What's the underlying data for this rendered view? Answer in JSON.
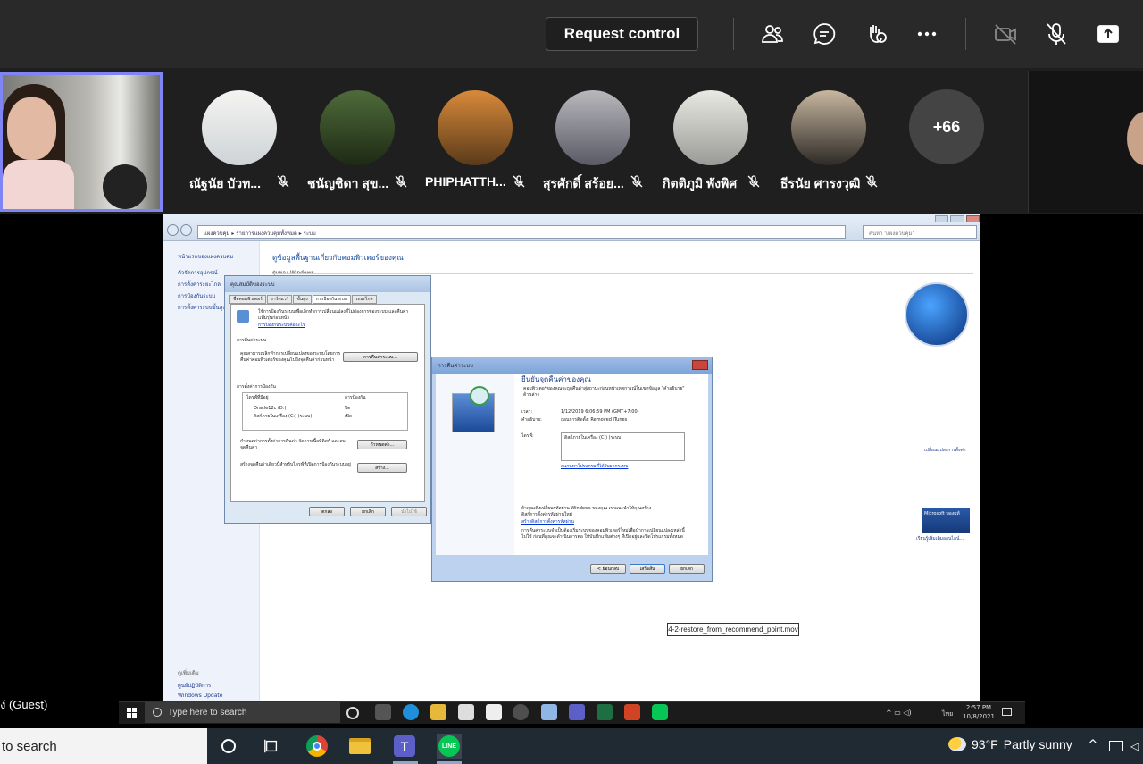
{
  "toolbar": {
    "request_control_label": "Request control",
    "icons": [
      "people-icon",
      "chat-icon",
      "raise-hand-icon",
      "more-icon",
      "camera-off-icon",
      "mic-off-icon",
      "share-tray-icon"
    ]
  },
  "participants": [
    {
      "name": "ณัฐนัย บัวท...",
      "muted": true
    },
    {
      "name": "ชนัญชิดา สุข...",
      "muted": true
    },
    {
      "name": "PHIPHATTH...",
      "muted": true
    },
    {
      "name": "สุรศักดิ์ สร้อย...",
      "muted": true
    },
    {
      "name": "กิตติภูมิ พังพิศ",
      "muted": true
    },
    {
      "name": "ธีรนัย ศารงวุฒิ",
      "muted": true
    }
  ],
  "overflow_count": "+66",
  "self_label": "ง่ (Guest)",
  "shared_screen": {
    "address": "แผงควบคุม ▸ รายการแผงควบคุมทั้งหมด ▸ ระบบ",
    "search_placeholder": "ค้นหา 'แผงควบคุม'",
    "left_nav": {
      "home": "หน้าแรกของแผงควบคุม",
      "items": [
        "ตัวจัดการอุปกรณ์",
        "การตั้งค่าระยะไกล",
        "การป้องกันระบบ",
        "การตั้งค่าระบบขั้นสูง"
      ],
      "see_also": "ดูเพิ่มเติม",
      "see_also_items": [
        "ศูนย์ปฏิบัติการ",
        "Windows Update"
      ]
    },
    "page_title": "ดูข้อมูลพื้นฐานเกี่ยวกับคอมพิวเตอร์ของคุณ",
    "edition_label": "รุ่นของ Windows",
    "change_settings": "เปลี่ยนแปลงการตั้งค่า",
    "genuine_label": "เรียนรู้เพิ่มเติมออนไลน์...",
    "genuine_badge": "Microsoft ของแท้",
    "sysprops": {
      "title": "คุณสมบัติของระบบ",
      "tabs": [
        "ชื่อคอมพิวเตอร์",
        "ฮาร์ดแวร์",
        "ขั้นสูง",
        "การป้องกันระบบ",
        "ระยะไกล"
      ],
      "intro": "ใช้การป้องกันระบบเพื่อเลิกทำการเปลี่ยนแปลงที่ไม่ต้องการของระบบ และคืนค่าแฟ้มรุ่นก่อนหน้า",
      "intro_link": "การป้องกันระบบคืออะไร",
      "restore_section": "การคืนค่าระบบ",
      "restore_text": "คุณสามารถเลิกทำการเปลี่ยนแปลงของระบบโดยการคืนค่าคอมพิวเตอร์ของคุณไปยังจุดคืนค่าก่อนหน้า",
      "restore_button": "การคืนค่าระบบ...",
      "protection_section": "การตั้งค่าการป้องกัน",
      "col_drive": "ไดรฟ์ที่มีอยู่",
      "col_protection": "การป้องกัน",
      "drives": [
        {
          "name": "Oracle12c (D:)",
          "state": "ปิด"
        },
        {
          "name": "ดิสก์ภายในเครื่อง (C:) (ระบบ)",
          "state": "เปิด"
        }
      ],
      "configure_text": "กำหนดค่าการตั้งค่าการคืนค่า จัดการเนื้อที่ดิสก์ และลบจุดคืนค่า",
      "configure_button": "กำหนดค่า...",
      "create_text": "สร้างจุดคืนค่าเดี๋ยวนี้สำหรับไดรฟ์ที่เปิดการป้องกันระบบอยู่",
      "create_button": "สร้าง...",
      "ok": "ตกลง",
      "cancel": "ยกเลิก",
      "apply": "นำไปใช้"
    },
    "restore": {
      "title": "การคืนค่าระบบ",
      "heading": "ยืนยันจุดคืนค่าของคุณ",
      "subheading": "คอมพิวเตอร์ของคุณจะถูกคืนค่าสู่สถานะก่อนหน้าเหตุการณ์ในเขตข้อมูล \"คำอธิบาย\" ด้านล่าง",
      "time_label": "เวลา:",
      "time_value": "1/12/2019 6:06:59 PM (GMT+7:00)",
      "desc_label": "คำอธิบาย:",
      "desc_value": "ถอนการติดตั้ง: Removed iTunes",
      "drives_label": "ไดรฟ์:",
      "drives_value": "ดิสก์ภายในเครื่อง (C:) (ระบบ)",
      "scan_link": "สแกนหาโปรแกรมที่ได้รับผลกระทบ",
      "note1": "ถ้าคุณเพิ่งเปลี่ยนรหัสผ่าน Windows ของคุณ เราแนะนำให้คุณสร้างดิสก์การตั้งค่ารหัสผ่านใหม่",
      "note1_link": "สร้างดิสก์การตั้งค่ารหัสผ่าน",
      "note2": "การคืนค่าระบบจำเป็นต้องเริ่มระบบของคอมพิวเตอร์ใหม่เพื่อนำการเปลี่ยนแปลงเหล่านี้ไปใช้ ก่อนที่คุณจะดำเนินการต่อ ให้บันทึกแฟ้มต่างๆ ที่เปิดอยู่และปิดโปรแกรมทั้งหมด",
      "back": "< ย้อนกลับ",
      "finish": "เสร็จสิ้น",
      "cancel": "ยกเลิก"
    },
    "video_filename": "4-2-restore_from_recommend_point.mov",
    "vm_taskbar": {
      "search_placeholder": "Type here to search",
      "lang": "ไทย",
      "time": "2:57 PM",
      "date": "10/8/2021"
    }
  },
  "host_taskbar": {
    "search_text": "to search",
    "weather_temp": "93°F",
    "weather_desc": "Partly sunny"
  },
  "colors": {
    "topbar": "#292929",
    "strip": "#1f1f1f",
    "self_border": "#7f85f5",
    "host_taskbar": "#202a33"
  }
}
